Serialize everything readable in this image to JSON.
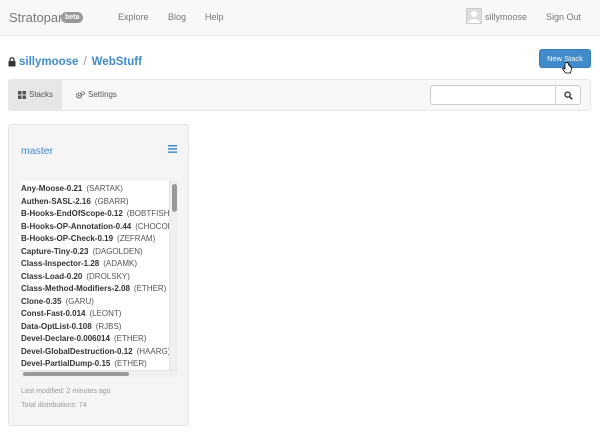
{
  "navbar": {
    "brand": "Stratopan",
    "badge": "beta",
    "links": [
      "Explore",
      "Blog",
      "Help"
    ],
    "username": "sillymoose",
    "signout": "Sign Out"
  },
  "breadcrumb": {
    "owner": "sillymoose",
    "separator": "/",
    "repo": "WebStuff"
  },
  "actions": {
    "new_stack": "New Stack"
  },
  "subnav": {
    "tabs": [
      {
        "label": "Stacks",
        "icon": "grid-icon",
        "active": true
      },
      {
        "label": "Settings",
        "icon": "gears-icon",
        "active": false
      }
    ],
    "search": {
      "value": "",
      "placeholder": ""
    }
  },
  "stack": {
    "name": "master",
    "distributions": [
      {
        "name": "Any-Moose-0.21",
        "author": "(SARTAK)"
      },
      {
        "name": "Authen-SASL-2.16",
        "author": "(GBARR)"
      },
      {
        "name": "B-Hooks-EndOfScope-0.12",
        "author": "(BOBTFISH)"
      },
      {
        "name": "B-Hooks-OP-Annotation-0.44",
        "author": "(CHOCOLATE)"
      },
      {
        "name": "B-Hooks-OP-Check-0.19",
        "author": "(ZEFRAM)"
      },
      {
        "name": "Capture-Tiny-0.23",
        "author": "(DAGOLDEN)"
      },
      {
        "name": "Class-Inspector-1.28",
        "author": "(ADAMK)"
      },
      {
        "name": "Class-Load-0.20",
        "author": "(DROLSKY)"
      },
      {
        "name": "Class-Method-Modifiers-2.08",
        "author": "(ETHER)"
      },
      {
        "name": "Clone-0.35",
        "author": "(GARU)"
      },
      {
        "name": "Const-Fast-0.014",
        "author": "(LEONT)"
      },
      {
        "name": "Data-OptList-0.108",
        "author": "(RJBS)"
      },
      {
        "name": "Devel-Declare-0.006014",
        "author": "(ETHER)"
      },
      {
        "name": "Devel-GlobalDestruction-0.12",
        "author": "(HAARG)"
      },
      {
        "name": "Devel-PartialDump-0.15",
        "author": "(ETHER)"
      }
    ],
    "last_modified": "Last modified: 2 minutes ago",
    "total": "Total distributions: 74"
  },
  "colors": {
    "accent": "#428bca",
    "navbar_bg": "#f8f8f8",
    "panel_bg": "#f5f5f5"
  }
}
